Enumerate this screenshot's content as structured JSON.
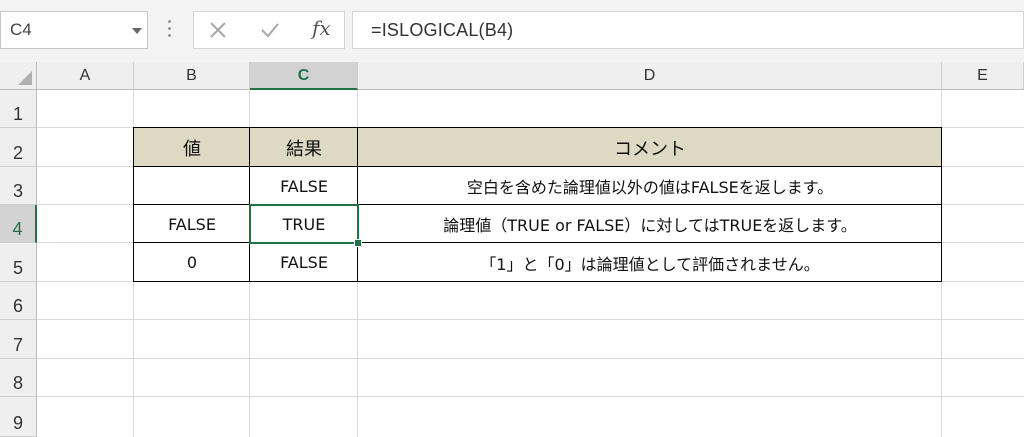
{
  "formula_bar": {
    "name_box": "C4",
    "cancel_icon": "x-icon",
    "enter_icon": "check-icon",
    "fx_label": "fx",
    "formula": "=ISLOGICAL(B4)"
  },
  "columns": [
    "A",
    "B",
    "C",
    "D",
    "E"
  ],
  "rows": [
    "1",
    "2",
    "3",
    "4",
    "5",
    "6",
    "7",
    "8",
    "9"
  ],
  "selected_cell": "C4",
  "table": {
    "headers": [
      "値",
      "結果",
      "コメント"
    ],
    "rows": [
      {
        "value": "",
        "result": "FALSE",
        "comment": "空白を含めた論理値以外の値はFALSEを返します。"
      },
      {
        "value": "FALSE",
        "result": "TRUE",
        "comment": "論理値（TRUE or FALSE）に対してはTRUEを返します。"
      },
      {
        "value": "0",
        "result": "FALSE",
        "comment": "「1」と「0」は論理値として評価されません。"
      }
    ]
  },
  "colors": {
    "header_fill": "#ddd9c3",
    "selection_accent": "#217346"
  }
}
